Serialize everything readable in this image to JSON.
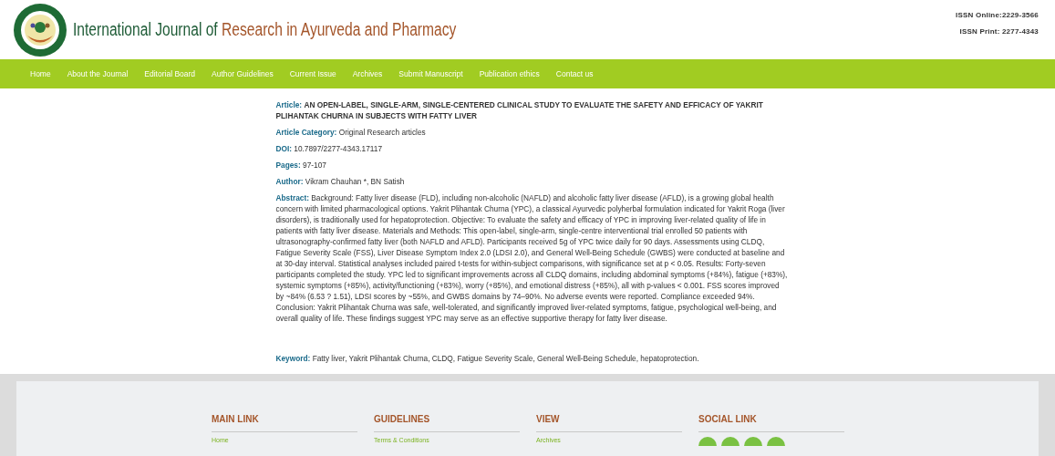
{
  "header": {
    "title_lead": "International Journal of ",
    "title_highlight": "Research in Ayurveda and Pharmacy",
    "issn": [
      "ISSN Online:2229-3566",
      "ISSN Print: 2277-4343"
    ]
  },
  "nav": [
    "Home",
    "About the Journal",
    "Editorial Board",
    "Author Guidelines",
    "Current Issue",
    "Archives",
    "Submit Manuscript",
    "Publication ethics",
    "Contact us"
  ],
  "article": {
    "fields": [
      {
        "kind": "title",
        "label": "Article:",
        "value": "AN OPEN-LABEL, SINGLE-ARM, SINGLE-CENTERED CLINICAL STUDY TO EVALUATE THE SAFETY AND EFFICACY OF YAKRIT PLIHANTAK CHURNA IN SUBJECTS WITH FATTY LIVER"
      },
      {
        "kind": "plain",
        "label": "Article Category:",
        "value": "Original Research articles"
      },
      {
        "kind": "plain",
        "label": "DOI:",
        "value": "10.7897/2277-4343.17117"
      },
      {
        "kind": "plain",
        "label": "Pages:",
        "value": "97-107"
      },
      {
        "kind": "plain",
        "label": "Author:",
        "value": "Vikram Chauhan *, BN Satish"
      },
      {
        "kind": "plain",
        "label": "Abstract:",
        "value": "Background: Fatty liver disease (FLD), including non-alcoholic (NAFLD) and alcoholic fatty liver disease (AFLD), is a growing global health concern with limited pharmacological options. Yakrit Plihantak Churna (YPC), a classical Ayurvedic polyherbal formulation indicated for Yakrit Roga (liver disorders), is traditionally used for hepatoprotection. Objective: To evaluate the safety and efficacy of YPC in improving liver-related quality of life in patients with fatty liver disease. Materials and Methods: This open-label, single-arm, single-centre interventional trial enrolled 50 patients with ultrasonography-confirmed fatty liver (both NAFLD and AFLD). Participants received 5g of YPC twice daily for 90 days. Assessments using CLDQ, Fatigue Severity Scale (FSS), Liver Disease Symptom Index 2.0 (LDSI 2.0), and General Well-Being Schedule (GWBS) were conducted at baseline and at 30-day interval. Statistical analyses included paired t-tests for within-subject comparisons, with significance set at p < 0.05. Results: Forty-seven participants completed the study. YPC led to significant improvements across all CLDQ domains, including abdominal symptoms (+84%), fatigue (+83%), systemic symptoms (+85%), activity/functioning (+83%), worry (+85%), and emotional distress (+85%), all with p-values < 0.001. FSS scores improved by ~84% (6.53 ? 1.51), LDSI scores by ~55%, and GWBS domains by 74–90%. No adverse events were reported. Compliance exceeded 94%. Conclusion: Yakrit Plihantak Churna was safe, well-tolerated, and significantly improved liver-related symptoms, fatigue, psychological well-being, and overall quality of life. These findings suggest YPC may serve as an effective supportive therapy for fatty liver disease."
      },
      {
        "kind": "keyword",
        "label": "Keyword:",
        "value": "Fatty liver, Yakrit Plihantak Churna, CLDQ, Fatigue Severity Scale, General Well-Being Schedule, hepatoprotection."
      }
    ]
  },
  "footer": {
    "columns": [
      {
        "heading": "MAIN LINK",
        "kind": "links",
        "links": [
          "Home"
        ]
      },
      {
        "heading": "GUIDELINES",
        "kind": "links",
        "links": [
          "Terms & Conditions"
        ]
      },
      {
        "heading": "VIEW",
        "kind": "links",
        "links": [
          "Archives"
        ]
      },
      {
        "heading": "SOCIAL LINK",
        "kind": "social"
      }
    ]
  }
}
